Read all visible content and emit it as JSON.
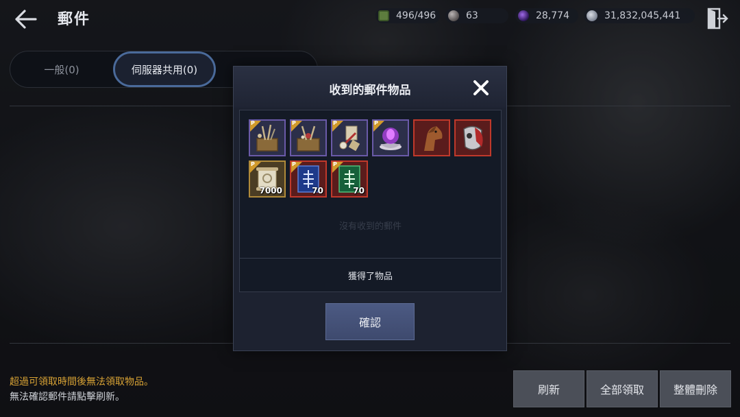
{
  "header": {
    "title": "郵件",
    "back_icon": "back-arrow-icon",
    "exit_icon": "exit-door-icon"
  },
  "currencies": {
    "stamina": {
      "value": "496/496",
      "icon": "stamina-icon"
    },
    "pearl": {
      "value": "63",
      "icon": "pearl-icon"
    },
    "crystal": {
      "value": "28,774",
      "icon": "crystal-icon"
    },
    "silver": {
      "value": "31,832,045,441",
      "icon": "silver-coin-icon"
    }
  },
  "tabs": [
    {
      "label": "一般(0)",
      "active": false
    },
    {
      "label": "伺服器共用(0)",
      "active": true
    },
    {
      "label": "",
      "active": false
    }
  ],
  "notices": {
    "warning": "超過可領取時間後無法領取物品。",
    "info": "無法確認郵件請點擊刷新。"
  },
  "actions": {
    "refresh": "刷新",
    "claim_all": "全部領取",
    "delete_all": "整體刪除"
  },
  "modal": {
    "title": "收到的郵件物品",
    "result_text": "獲得了物品",
    "confirm": "確認",
    "empty_hint": "沒有收到的郵件",
    "items": [
      {
        "icon": "tool-crate-icon",
        "badge": "P",
        "quantity": ""
      },
      {
        "icon": "gift-crate-icon",
        "badge": "P",
        "quantity": ""
      },
      {
        "icon": "scroll-set-icon",
        "badge": "P",
        "quantity": ""
      },
      {
        "icon": "purple-flame-bowl-icon",
        "badge": "P",
        "quantity": ""
      },
      {
        "icon": "horse-head-icon",
        "badge": "",
        "quantity": ""
      },
      {
        "icon": "horse-armor-icon",
        "badge": "",
        "quantity": ""
      },
      {
        "icon": "scroll-icon",
        "badge": "P",
        "quantity": "7000"
      },
      {
        "icon": "blue-skill-book-icon",
        "badge": "P",
        "quantity": "70"
      },
      {
        "icon": "green-skill-book-icon",
        "badge": "P",
        "quantity": "70"
      }
    ]
  }
}
